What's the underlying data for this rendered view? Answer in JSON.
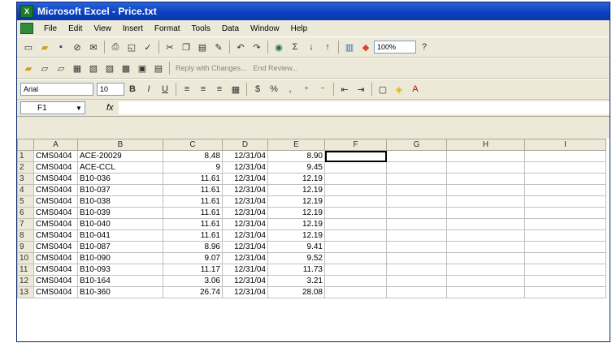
{
  "window": {
    "title": "Microsoft Excel - Price.txt",
    "app_icon_letter": "X"
  },
  "menu": [
    "File",
    "Edit",
    "View",
    "Insert",
    "Format",
    "Tools",
    "Data",
    "Window",
    "Help"
  ],
  "toolbar": {
    "zoom": "100%",
    "reply_text": "Reply with Changes...",
    "end_review": "End Review..."
  },
  "format_bar": {
    "font": "Arial",
    "size": "10"
  },
  "formula_bar": {
    "cell_ref": "F1",
    "fx": "fx",
    "formula": ""
  },
  "sheet": {
    "columns": [
      "A",
      "B",
      "C",
      "D",
      "E",
      "F",
      "G",
      "H",
      "I"
    ],
    "rows": [
      {
        "n": "1",
        "a": "CMS0404",
        "b": "ACE-20029",
        "c": "8.48",
        "d": "12/31/04",
        "e": "8.90"
      },
      {
        "n": "2",
        "a": "CMS0404",
        "b": "ACE-CCL",
        "c": "9",
        "d": "12/31/04",
        "e": "9.45"
      },
      {
        "n": "3",
        "a": "CMS0404",
        "b": "B10-036",
        "c": "11.61",
        "d": "12/31/04",
        "e": "12.19"
      },
      {
        "n": "4",
        "a": "CMS0404",
        "b": "B10-037",
        "c": "11.61",
        "d": "12/31/04",
        "e": "12.19"
      },
      {
        "n": "5",
        "a": "CMS0404",
        "b": "B10-038",
        "c": "11.61",
        "d": "12/31/04",
        "e": "12.19"
      },
      {
        "n": "6",
        "a": "CMS0404",
        "b": "B10-039",
        "c": "11.61",
        "d": "12/31/04",
        "e": "12.19"
      },
      {
        "n": "7",
        "a": "CMS0404",
        "b": "B10-040",
        "c": "11.61",
        "d": "12/31/04",
        "e": "12.19"
      },
      {
        "n": "8",
        "a": "CMS0404",
        "b": "B10-041",
        "c": "11.61",
        "d": "12/31/04",
        "e": "12.19"
      },
      {
        "n": "9",
        "a": "CMS0404",
        "b": "B10-087",
        "c": "8.96",
        "d": "12/31/04",
        "e": "9.41"
      },
      {
        "n": "10",
        "a": "CMS0404",
        "b": "B10-090",
        "c": "9.07",
        "d": "12/31/04",
        "e": "9.52"
      },
      {
        "n": "11",
        "a": "CMS0404",
        "b": "B10-093",
        "c": "11.17",
        "d": "12/31/04",
        "e": "11.73"
      },
      {
        "n": "12",
        "a": "CMS0404",
        "b": "B10-164",
        "c": "3.06",
        "d": "12/31/04",
        "e": "3.21"
      },
      {
        "n": "13",
        "a": "CMS0404",
        "b": "B10-360",
        "c": "26.74",
        "d": "12/31/04",
        "e": "28.08"
      }
    ]
  }
}
